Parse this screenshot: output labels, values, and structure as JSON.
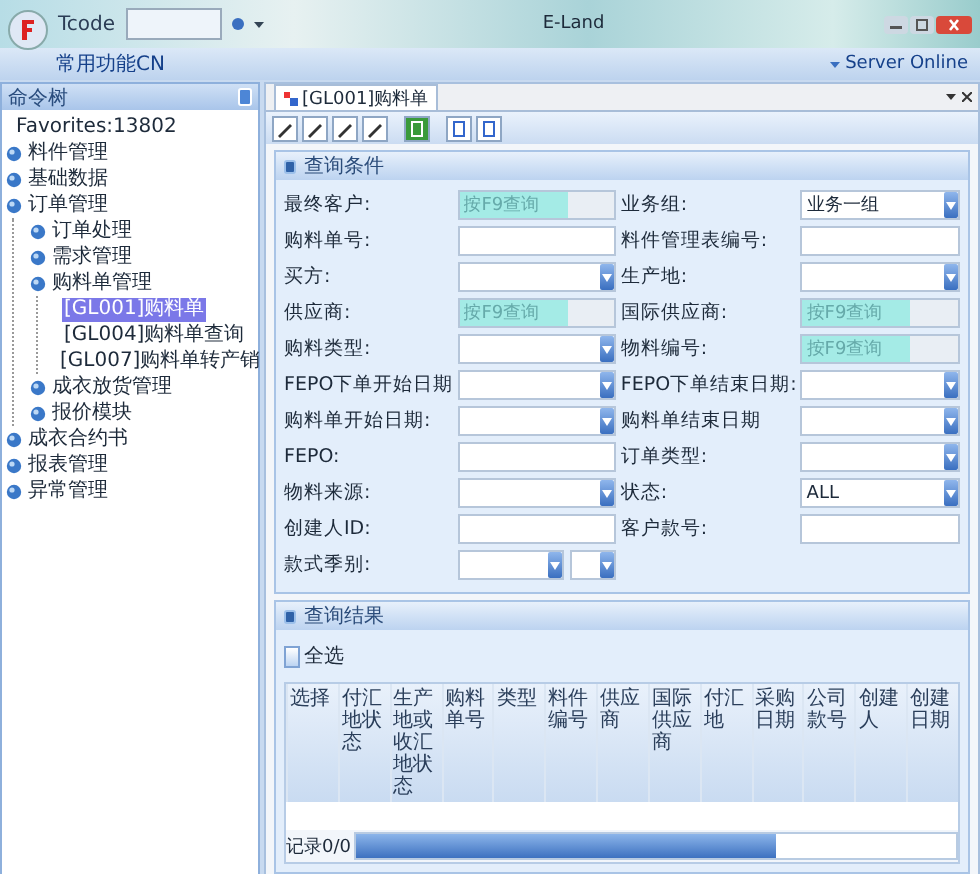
{
  "window": {
    "title": "E-Land",
    "tcode_label": "Tcode"
  },
  "menu": {
    "items": [
      "常用功能CN"
    ],
    "status": "Server Online"
  },
  "sidebar": {
    "title": "命令树",
    "tree": [
      {
        "label": "Favorites:13802",
        "kind": "leaf",
        "selected": false
      },
      {
        "label": "料件管理",
        "kind": "folder",
        "selected": false
      },
      {
        "label": "基础数据",
        "kind": "folder",
        "selected": false
      },
      {
        "label": "订单管理",
        "kind": "folder",
        "selected": false,
        "children": [
          {
            "label": "订单处理",
            "kind": "folder",
            "selected": false
          },
          {
            "label": "需求管理",
            "kind": "folder",
            "selected": false
          },
          {
            "label": "购料单管理",
            "kind": "folder",
            "selected": false,
            "children": [
              {
                "label": "[GL001]购料单",
                "kind": "leaf",
                "selected": true
              },
              {
                "label": "[GL004]购料单查询",
                "kind": "leaf",
                "selected": false
              },
              {
                "label": "[GL007]购料单转产销",
                "kind": "leaf",
                "selected": false
              }
            ]
          },
          {
            "label": "成衣放货管理",
            "kind": "folder",
            "selected": false
          },
          {
            "label": "报价模块",
            "kind": "folder",
            "selected": false
          }
        ]
      },
      {
        "label": "成衣合约书",
        "kind": "folder",
        "selected": false
      },
      {
        "label": "报表管理",
        "kind": "folder",
        "selected": false
      },
      {
        "label": "异常管理",
        "kind": "folder",
        "selected": false
      }
    ]
  },
  "tabs": [
    {
      "label": "[GL001]购料单",
      "selected": true
    }
  ],
  "query": {
    "title": "查询条件",
    "rows": [
      [
        {
          "label": "最终客户:",
          "kind": "lookup",
          "placeholder": "按F9查询"
        },
        {
          "label": "业务组:",
          "kind": "select",
          "value": "业务一组"
        }
      ],
      [
        {
          "label": "购料单号:",
          "kind": "text"
        },
        {
          "label": "料件管理表编号:",
          "kind": "text"
        }
      ],
      [
        {
          "label": "买方:",
          "kind": "select"
        },
        {
          "label": "生产地:",
          "kind": "select"
        }
      ],
      [
        {
          "label": "供应商:",
          "kind": "lookup",
          "placeholder": "按F9查询"
        },
        {
          "label": "国际供应商:",
          "kind": "lookup",
          "placeholder": "按F9查询"
        }
      ],
      [
        {
          "label": "购料类型:",
          "kind": "select"
        },
        {
          "label": "物料编号:",
          "kind": "lookup",
          "placeholder": "按F9查询"
        }
      ],
      [
        {
          "label": "FEPO下单开始日期",
          "kind": "select"
        },
        {
          "label": "FEPO下单结束日期:",
          "kind": "select"
        }
      ],
      [
        {
          "label": "购料单开始日期:",
          "kind": "select"
        },
        {
          "label": "购料单结束日期",
          "kind": "select"
        }
      ],
      [
        {
          "label": "FEPO:",
          "kind": "text"
        },
        {
          "label": "订单类型:",
          "kind": "select"
        }
      ],
      [
        {
          "label": "物料来源:",
          "kind": "select"
        },
        {
          "label": "状态:",
          "kind": "select",
          "value": "ALL"
        }
      ],
      [
        {
          "label": "创建人ID:",
          "kind": "text"
        },
        {
          "label": "客户款号:",
          "kind": "text"
        }
      ],
      [
        {
          "label": "款式季别:",
          "kind": "select-pair"
        }
      ]
    ]
  },
  "results": {
    "title": "查询结果",
    "select_all": {
      "label": "全选",
      "checked": false
    },
    "columns": [
      "选择",
      "付汇地状态",
      "生产地或收汇地状态",
      "购料单号",
      "类型",
      "料件编号",
      "供应商",
      "国际供应商",
      "付汇地",
      "采购日期",
      "公司款号",
      "创建人",
      "创建日期"
    ],
    "footer": "记录0/0"
  }
}
